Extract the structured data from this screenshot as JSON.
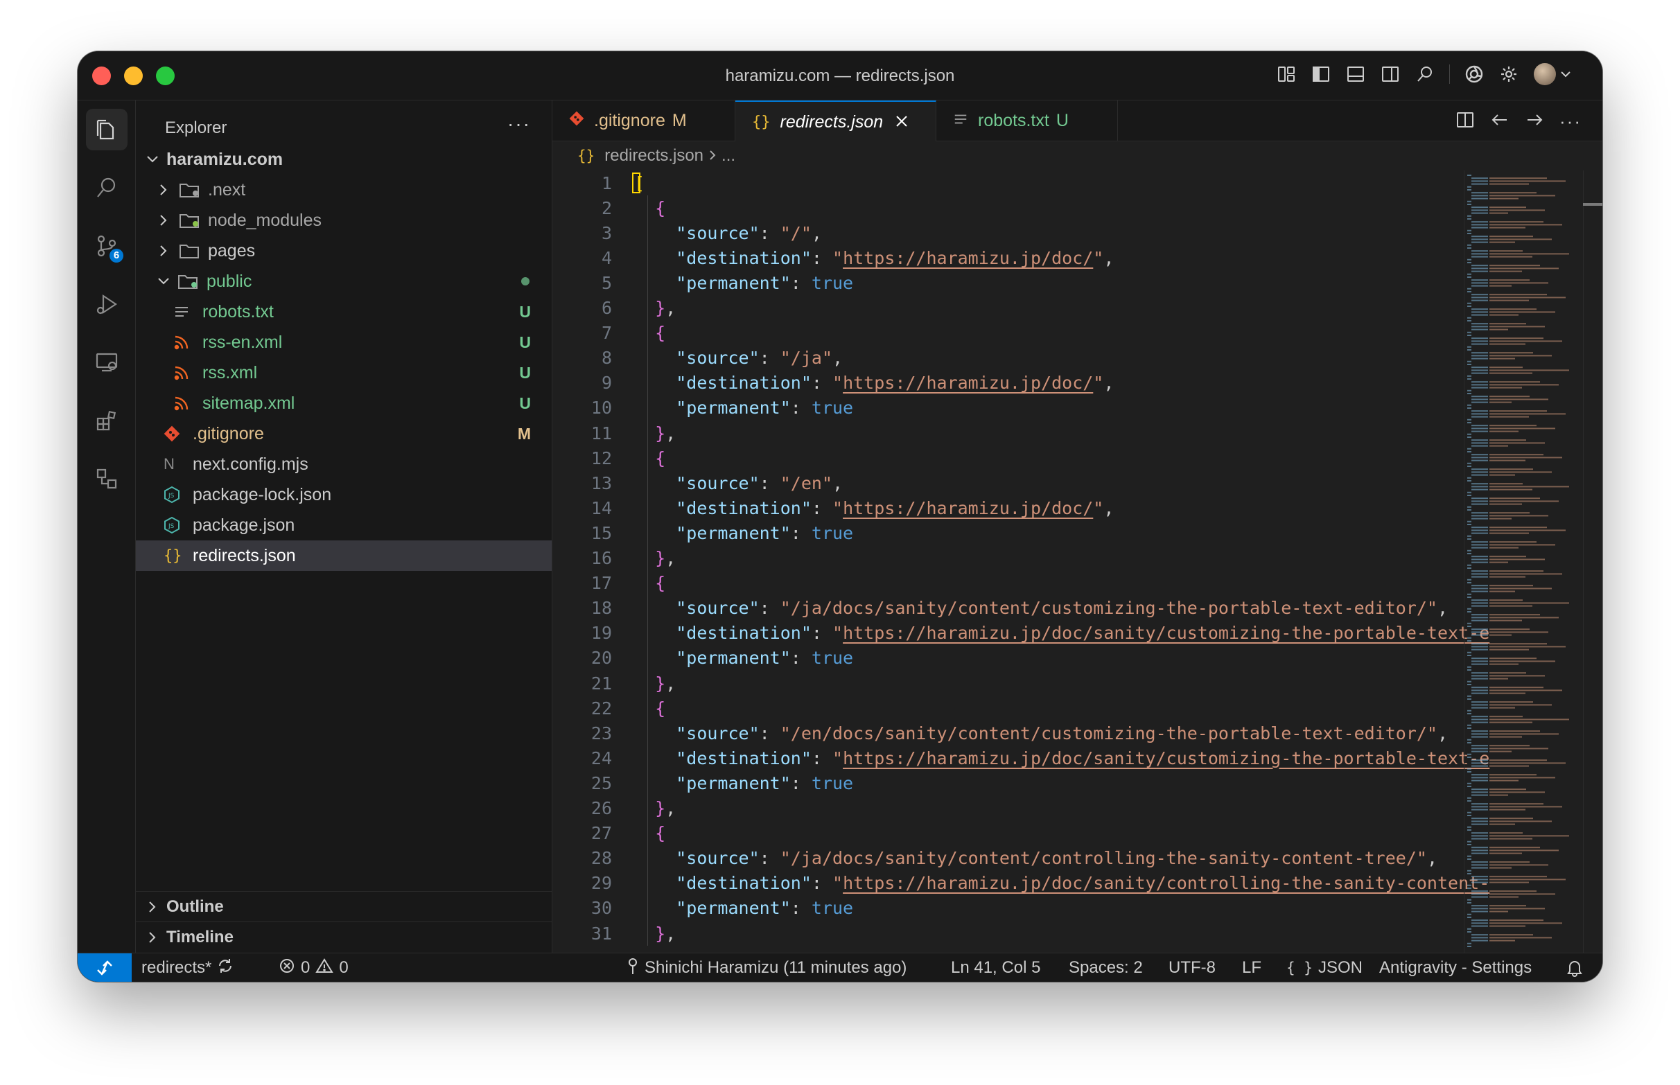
{
  "window": {
    "title": "haramizu.com — redirects.json"
  },
  "colors": {
    "accent": "#0078d4",
    "modified": "#e2c08d",
    "untracked": "#73c991",
    "json_brace": "#e8ba36"
  },
  "sidebar": {
    "header": "Explorer",
    "more": "···",
    "root": "haramizu.com",
    "items": [
      {
        "label": ".next",
        "status": ""
      },
      {
        "label": "node_modules",
        "status": ""
      },
      {
        "label": "pages",
        "status": ""
      },
      {
        "label": "public",
        "status": ""
      },
      {
        "label": "robots.txt",
        "status": "U"
      },
      {
        "label": "rss-en.xml",
        "status": "U"
      },
      {
        "label": "rss.xml",
        "status": "U"
      },
      {
        "label": "sitemap.xml",
        "status": "U"
      },
      {
        "label": ".gitignore",
        "status": "M"
      },
      {
        "label": "next.config.mjs",
        "status": ""
      },
      {
        "label": "package-lock.json",
        "status": ""
      },
      {
        "label": "package.json",
        "status": ""
      },
      {
        "label": "redirects.json",
        "status": ""
      }
    ],
    "outline": "Outline",
    "timeline": "Timeline"
  },
  "activity": {
    "scm_badge": "6"
  },
  "tabs": [
    {
      "label": ".gitignore",
      "status": "M"
    },
    {
      "label": "redirects.json",
      "status": ""
    },
    {
      "label": "robots.txt",
      "status": "U"
    }
  ],
  "breadcrumb": {
    "file": "redirects.json",
    "rest": "..."
  },
  "editor": {
    "line_numbers": [
      "1",
      "2",
      "3",
      "4",
      "5",
      "6",
      "7",
      "8",
      "9",
      "10",
      "11",
      "12",
      "13",
      "14",
      "15",
      "16",
      "17",
      "18",
      "19",
      "20",
      "21",
      "22",
      "23",
      "24",
      "25",
      "26",
      "27",
      "28",
      "29",
      "30",
      "31"
    ],
    "entries": [
      {
        "source": "/",
        "destination": "https://haramizu.jp/doc/"
      },
      {
        "source": "/ja",
        "destination": "https://haramizu.jp/doc/"
      },
      {
        "source": "/en",
        "destination": "https://haramizu.jp/doc/"
      },
      {
        "source": "/ja/docs/sanity/content/customizing-the-portable-text-editor/",
        "destination": "https://haramizu.jp/doc/sanity/customizing-the-portable-text-e"
      },
      {
        "source": "/en/docs/sanity/content/customizing-the-portable-text-editor/",
        "destination": "https://haramizu.jp/doc/sanity/customizing-the-portable-text-e"
      },
      {
        "source": "/ja/docs/sanity/content/controlling-the-sanity-content-tree/",
        "destination": "https://haramizu.jp/doc/sanity/controlling-the-sanity-content-"
      }
    ],
    "key_source": "\"source\"",
    "key_destination": "\"destination\"",
    "key_permanent": "\"permanent\"",
    "val_true": "true"
  },
  "statusbar": {
    "branch": "redirects*",
    "errors": "0",
    "warnings": "0",
    "blame": "Shinichi Haramizu (11 minutes ago)",
    "position": "Ln 41, Col 5",
    "spaces": "Spaces: 2",
    "encoding": "UTF-8",
    "eol": "LF",
    "language": "JSON",
    "settings": "Antigravity - Settings"
  }
}
